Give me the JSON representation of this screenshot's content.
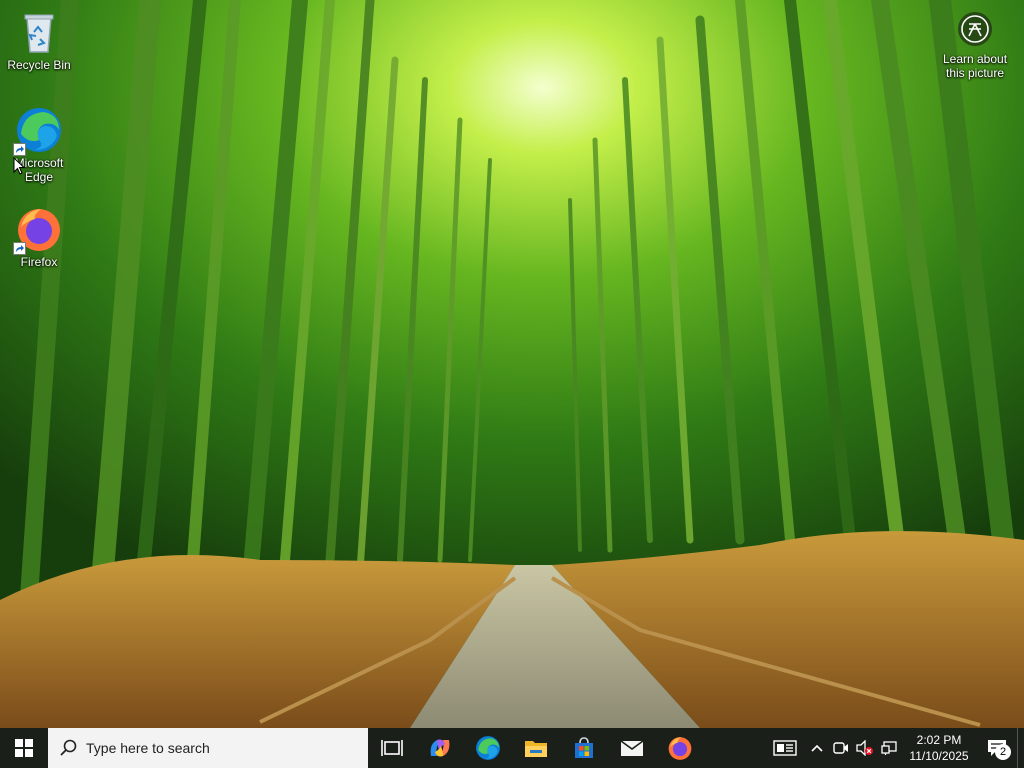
{
  "desktop": {
    "icons": [
      {
        "label": "Recycle Bin",
        "icon": "recycle-bin-icon"
      },
      {
        "label": "Microsoft Edge",
        "icon": "edge-icon"
      },
      {
        "label": "Firefox",
        "icon": "firefox-icon"
      }
    ],
    "learn_picture": {
      "label": "Learn about this picture",
      "icon": "camera-icon"
    }
  },
  "taskbar": {
    "start_icon": "windows-start-icon",
    "search": {
      "placeholder": "Type here to search",
      "icon": "search-icon"
    },
    "pinned": [
      {
        "name": "task-view",
        "icon": "task-view-icon"
      },
      {
        "name": "copilot",
        "icon": "copilot-icon"
      },
      {
        "name": "edge",
        "icon": "edge-icon"
      },
      {
        "name": "file-explorer",
        "icon": "folder-icon"
      },
      {
        "name": "microsoft-store",
        "icon": "store-icon"
      },
      {
        "name": "mail",
        "icon": "mail-icon"
      },
      {
        "name": "firefox",
        "icon": "firefox-icon"
      }
    ],
    "tray": {
      "icons": [
        "news-widget-icon",
        "chevron-up-icon",
        "meet-now-icon",
        "volume-muted-icon",
        "network-icon"
      ],
      "time": "2:02 PM",
      "date": "11/10/2025",
      "notifications_count": "2"
    }
  },
  "colors": {
    "taskbar_bg": "#1b1f1a",
    "search_bg": "#f3f3f3",
    "edge_blue": "#0c7fd6",
    "edge_green": "#4ccb5c",
    "firefox_orange": "#ff7139",
    "firefox_purple": "#7542e5"
  }
}
